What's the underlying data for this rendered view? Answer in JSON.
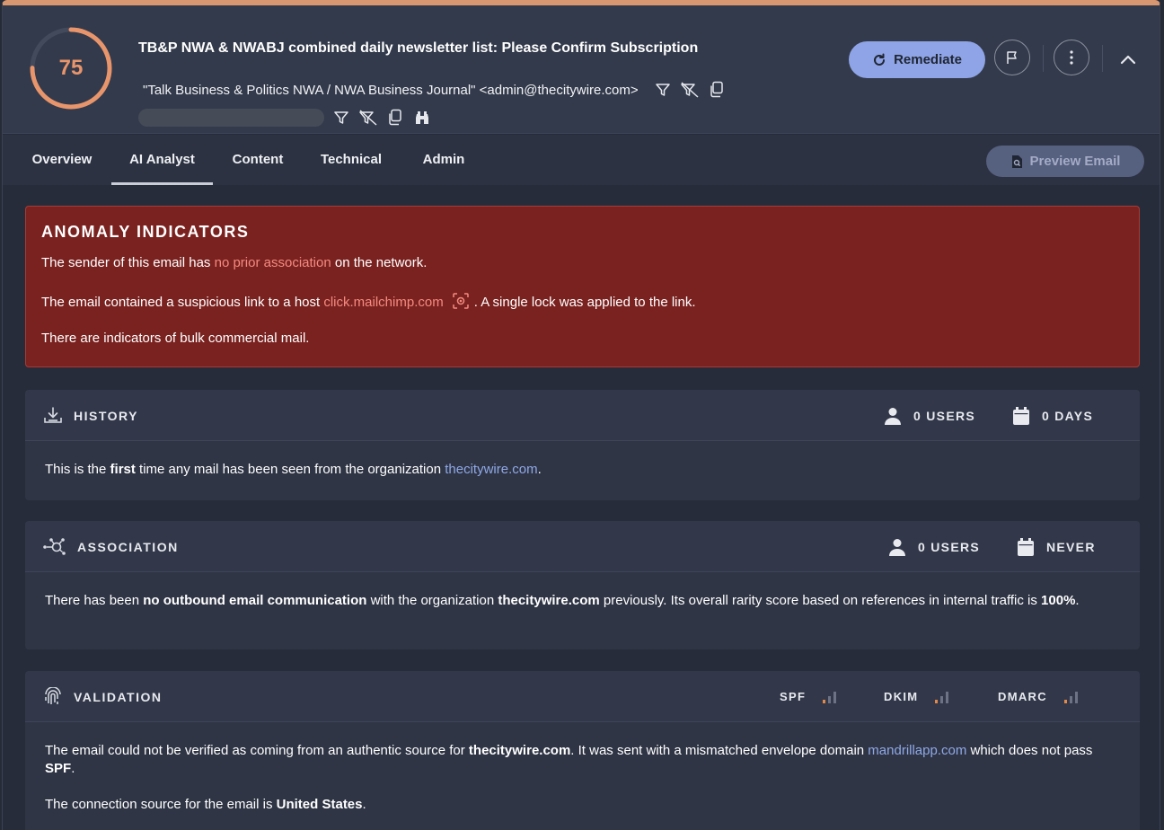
{
  "header": {
    "score": "75",
    "score_fraction": 0.75,
    "accent_color": "#d99771",
    "subject": "TB&P NWA & NWABJ combined daily newsletter list: Please Confirm Subscription",
    "sender": "\"Talk Business & Politics NWA / NWA Business Journal\" <admin@thecitywire.com>",
    "sender_icons": [
      "filter-icon",
      "filter-clear-icon",
      "copy-icon"
    ],
    "recipient_icons": [
      "filter-icon",
      "filter-clear-icon",
      "copy-icon",
      "binoculars-icon"
    ],
    "remediate_label": "Remediate",
    "actions": [
      "flag-icon",
      "more-vertical-icon",
      "chevron-up-icon"
    ]
  },
  "tabs": [
    {
      "label": "Overview",
      "active": false
    },
    {
      "label": "AI Analyst",
      "active": true
    },
    {
      "label": "Content",
      "active": false
    },
    {
      "label": "Technical",
      "active": false
    },
    {
      "label": "Admin",
      "active": false
    }
  ],
  "preview_label": "Preview Email",
  "anomaly": {
    "title": "ANOMALY INDICATORS",
    "line1": {
      "pre": "The sender of this email has ",
      "highlight": "no prior association",
      "post": " on the network."
    },
    "line2": {
      "pre": "The email contained a suspicious link to a host ",
      "highlight": "click.mailchimp.com",
      "post": ". A single lock was applied to the link."
    },
    "line3": "There are indicators of bulk commercial mail."
  },
  "history": {
    "title": "HISTORY",
    "users": "0 USERS",
    "days": "0 DAYS",
    "body": {
      "pre": "This is the ",
      "bold": "first",
      "mid": " time any mail has been seen from the organization ",
      "link": "thecitywire.com",
      "post": "."
    }
  },
  "association": {
    "title": "ASSOCIATION",
    "users": "0 USERS",
    "last": "NEVER",
    "body": {
      "p1": "There has been ",
      "b1": "no outbound email communication",
      "p2": " with the organization ",
      "b2": "thecitywire.com",
      "p3": " previously. Its overall rarity score based on references in internal traffic is ",
      "b3": "100%",
      "p4": "."
    }
  },
  "validation": {
    "title": "VALIDATION",
    "checks": [
      "SPF",
      "DKIM",
      "DMARC"
    ],
    "body1": {
      "p1": "The email could not be verified as coming from an authentic source for ",
      "b1": "thecitywire.com",
      "p2": ". It was sent with a mismatched envelope domain ",
      "link": "mandrillapp.com",
      "p3": " which does not pass ",
      "b2": "SPF",
      "p4": "."
    },
    "body2": {
      "pre": "The connection source for the email is ",
      "bold": "United States",
      "post": "."
    }
  }
}
